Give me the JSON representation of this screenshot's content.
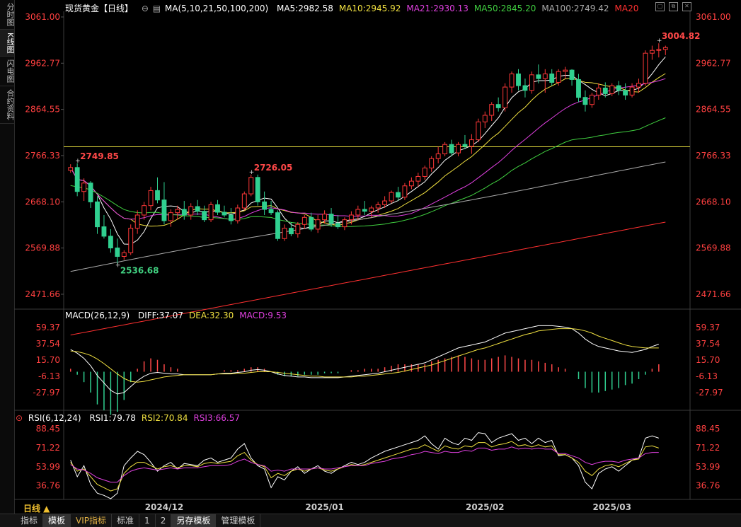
{
  "sidebar": {
    "tabs": [
      "分时图",
      "K线图",
      "闪电图",
      "合约资料"
    ],
    "active": 1
  },
  "main_legend": {
    "instrument": "现货黄金【日线】",
    "ma_params": "MA(5,10,21,50,100,200)",
    "items": [
      {
        "label": "MA5:2982.58",
        "color": "#ffffff"
      },
      {
        "label": "MA10:2945.92",
        "color": "#f0e040"
      },
      {
        "label": "MA21:2930.13",
        "color": "#e040e0"
      },
      {
        "label": "MA50:2845.20",
        "color": "#40d040"
      },
      {
        "label": "MA100:2749.42",
        "color": "#aaaaaa"
      },
      {
        "label": "MA20",
        "color": "#ff3030"
      }
    ]
  },
  "macd_legend": {
    "title": "MACD(26,12,9)",
    "items": [
      {
        "label": "DIFF:37.07",
        "color": "#ffffff"
      },
      {
        "label": "DEA:32.30",
        "color": "#f0e040"
      },
      {
        "label": "MACD:9.53",
        "color": "#e040e0"
      }
    ]
  },
  "rsi_legend": {
    "title": "RSI(6,12,24)",
    "items": [
      {
        "label": "RSI1:79.78",
        "color": "#ffffff"
      },
      {
        "label": "RSI2:70.84",
        "color": "#f0e040"
      },
      {
        "label": "RSI3:66.57",
        "color": "#e040e0"
      }
    ]
  },
  "period_button": "日线 ▲",
  "bottom_tabs": [
    {
      "label": "指标",
      "vip": false,
      "active": false
    },
    {
      "label": "模板",
      "vip": false,
      "active": true
    },
    {
      "label": "VIP指标",
      "vip": true,
      "active": false
    },
    {
      "label": "标准",
      "vip": false,
      "active": false
    },
    {
      "label": "1",
      "vip": false,
      "active": false
    },
    {
      "label": "2",
      "vip": false,
      "active": false
    },
    {
      "label": "另存模板",
      "vip": false,
      "active": true
    },
    {
      "label": "管理模板",
      "vip": false,
      "active": false
    }
  ],
  "colors": {
    "up": "#ff3838",
    "down": "#30d090",
    "price_axis": "#ff4040",
    "hline": "#e8e040"
  },
  "chart_data": [
    {
      "type": "candlestick",
      "title": "现货黄金【日线】",
      "price_ticks": [
        "3061.00",
        "2962.77",
        "2864.55",
        "2766.33",
        "2668.10",
        "2569.88",
        "2471.66"
      ],
      "ylim": [
        2440,
        3070
      ],
      "x_labels": [
        "2024/12",
        "2025/01",
        "2025/02",
        "2025/03"
      ],
      "annotations": [
        {
          "text": "3004.82",
          "type": "high"
        },
        {
          "text": "2749.85",
          "type": "high"
        },
        {
          "text": "2726.05",
          "type": "high"
        },
        {
          "text": "2536.68",
          "type": "low"
        }
      ],
      "horizontal_line": 2785,
      "candles": [
        [
          2735,
          2748,
          2730,
          2741
        ],
        [
          2741,
          2750,
          2680,
          2690
        ],
        [
          2690,
          2718,
          2670,
          2708
        ],
        [
          2708,
          2712,
          2655,
          2668
        ],
        [
          2668,
          2680,
          2600,
          2615
        ],
        [
          2615,
          2640,
          2590,
          2595
        ],
        [
          2595,
          2610,
          2560,
          2570
        ],
        [
          2570,
          2590,
          2537,
          2552
        ],
        [
          2552,
          2565,
          2545,
          2560
        ],
        [
          2560,
          2620,
          2555,
          2612
        ],
        [
          2612,
          2650,
          2600,
          2640
        ],
        [
          2640,
          2668,
          2630,
          2660
        ],
        [
          2660,
          2700,
          2650,
          2692
        ],
        [
          2692,
          2720,
          2665,
          2672
        ],
        [
          2672,
          2710,
          2620,
          2628
        ],
        [
          2628,
          2652,
          2615,
          2645
        ],
        [
          2645,
          2660,
          2630,
          2652
        ],
        [
          2652,
          2670,
          2630,
          2640
        ],
        [
          2640,
          2665,
          2630,
          2658
        ],
        [
          2658,
          2672,
          2640,
          2648
        ],
        [
          2648,
          2660,
          2625,
          2630
        ],
        [
          2630,
          2668,
          2625,
          2662
        ],
        [
          2662,
          2672,
          2640,
          2646
        ],
        [
          2646,
          2660,
          2635,
          2640
        ],
        [
          2640,
          2655,
          2620,
          2628
        ],
        [
          2628,
          2662,
          2622,
          2655
        ],
        [
          2655,
          2690,
          2650,
          2685
        ],
        [
          2685,
          2726,
          2680,
          2720
        ],
        [
          2720,
          2726,
          2660,
          2668
        ],
        [
          2668,
          2690,
          2640,
          2652
        ],
        [
          2652,
          2670,
          2640,
          2645
        ],
        [
          2645,
          2650,
          2585,
          2590
        ],
        [
          2590,
          2620,
          2585,
          2612
        ],
        [
          2612,
          2625,
          2595,
          2600
        ],
        [
          2600,
          2625,
          2592,
          2620
        ],
        [
          2620,
          2640,
          2610,
          2635
        ],
        [
          2635,
          2645,
          2605,
          2610
        ],
        [
          2610,
          2640,
          2602,
          2630
        ],
        [
          2630,
          2650,
          2622,
          2642
        ],
        [
          2642,
          2655,
          2615,
          2622
        ],
        [
          2622,
          2640,
          2610,
          2615
        ],
        [
          2615,
          2635,
          2608,
          2630
        ],
        [
          2630,
          2648,
          2620,
          2640
        ],
        [
          2640,
          2660,
          2630,
          2652
        ],
        [
          2652,
          2670,
          2640,
          2648
        ],
        [
          2648,
          2660,
          2635,
          2655
        ],
        [
          2655,
          2668,
          2645,
          2662
        ],
        [
          2662,
          2680,
          2655,
          2670
        ],
        [
          2670,
          2692,
          2665,
          2688
        ],
        [
          2688,
          2700,
          2670,
          2678
        ],
        [
          2678,
          2708,
          2672,
          2702
        ],
        [
          2702,
          2720,
          2695,
          2712
        ],
        [
          2712,
          2730,
          2700,
          2722
        ],
        [
          2722,
          2745,
          2715,
          2740
        ],
        [
          2740,
          2765,
          2732,
          2760
        ],
        [
          2760,
          2785,
          2750,
          2770
        ],
        [
          2770,
          2795,
          2765,
          2790
        ],
        [
          2790,
          2800,
          2765,
          2772
        ],
        [
          2772,
          2795,
          2765,
          2790
        ],
        [
          2790,
          2810,
          2780,
          2786
        ],
        [
          2786,
          2812,
          2770,
          2800
        ],
        [
          2800,
          2845,
          2795,
          2838
        ],
        [
          2838,
          2860,
          2825,
          2852
        ],
        [
          2852,
          2880,
          2840,
          2875
        ],
        [
          2875,
          2890,
          2860,
          2868
        ],
        [
          2868,
          2920,
          2860,
          2912
        ],
        [
          2912,
          2945,
          2900,
          2940
        ],
        [
          2940,
          2950,
          2905,
          2915
        ],
        [
          2915,
          2930,
          2890,
          2905
        ],
        [
          2905,
          2945,
          2898,
          2938
        ],
        [
          2938,
          2960,
          2920,
          2930
        ],
        [
          2930,
          2950,
          2900,
          2940
        ],
        [
          2940,
          2950,
          2915,
          2922
        ],
        [
          2922,
          2950,
          2915,
          2945
        ],
        [
          2945,
          2955,
          2930,
          2948
        ],
        [
          2948,
          2950,
          2915,
          2928
        ],
        [
          2928,
          2940,
          2880,
          2890
        ],
        [
          2890,
          2905,
          2860,
          2875
        ],
        [
          2875,
          2900,
          2868,
          2895
        ],
        [
          2895,
          2920,
          2885,
          2910
        ],
        [
          2910,
          2922,
          2890,
          2898
        ],
        [
          2898,
          2920,
          2893,
          2915
        ],
        [
          2915,
          2925,
          2895,
          2905
        ],
        [
          2905,
          2920,
          2885,
          2895
        ],
        [
          2895,
          2920,
          2890,
          2912
        ],
        [
          2912,
          2930,
          2900,
          2920
        ],
        [
          2920,
          2990,
          2915,
          2984
        ],
        [
          2984,
          3000,
          2970,
          2990
        ],
        [
          2990,
          3005,
          2975,
          2992
        ],
        [
          2992,
          3000,
          2980,
          2996
        ]
      ]
    },
    {
      "type": "line",
      "title": "MACD(26,12,9)",
      "y_ticks": [
        "59.37",
        "37.54",
        "15.70",
        "-6.13",
        "-27.97"
      ],
      "ylim": [
        -50,
        70
      ],
      "series": [
        {
          "name": "DIFF",
          "values": [
            30,
            25,
            18,
            8,
            -5,
            -15,
            -25,
            -30,
            -28,
            -20,
            -12,
            -6,
            -2,
            -1,
            -2,
            -3,
            -3,
            -4,
            -4,
            -4,
            -4,
            -4,
            -3,
            -2,
            -2,
            -1,
            0,
            2,
            3,
            2,
            0,
            -3,
            -5,
            -6,
            -7,
            -7,
            -8,
            -8,
            -8,
            -8,
            -8,
            -7,
            -6,
            -5,
            -4,
            -3,
            -2,
            0,
            2,
            4,
            6,
            8,
            10,
            12,
            16,
            20,
            24,
            28,
            32,
            34,
            36,
            38,
            40,
            44,
            48,
            52,
            54,
            56,
            58,
            60,
            62,
            62,
            62,
            61,
            60,
            58,
            52,
            44,
            38,
            34,
            32,
            30,
            28,
            27,
            26,
            28,
            30,
            34,
            37
          ]
        },
        {
          "name": "DEA",
          "values": [
            28,
            27,
            25,
            22,
            17,
            11,
            4,
            -3,
            -9,
            -13,
            -14,
            -13,
            -11,
            -9,
            -7,
            -6,
            -5,
            -4,
            -4,
            -4,
            -4,
            -4,
            -3,
            -3,
            -3,
            -2,
            -2,
            -1,
            0,
            0,
            0,
            -1,
            -2,
            -3,
            -4,
            -5,
            -6,
            -6,
            -7,
            -7,
            -7,
            -7,
            -7,
            -6,
            -6,
            -5,
            -4,
            -3,
            -2,
            -1,
            1,
            3,
            5,
            7,
            9,
            12,
            15,
            18,
            21,
            24,
            27,
            30,
            32,
            35,
            38,
            41,
            44,
            47,
            50,
            52,
            55,
            56,
            57,
            58,
            58,
            58,
            57,
            55,
            52,
            48,
            45,
            42,
            39,
            36,
            34,
            33,
            32,
            32,
            32
          ]
        }
      ]
    },
    {
      "type": "line",
      "title": "RSI(6,12,24)",
      "y_ticks": [
        "88.45",
        "71.22",
        "53.99",
        "36.76"
      ],
      "ylim": [
        25,
        95
      ],
      "series": [
        {
          "name": "RSI1",
          "values": [
            60,
            45,
            55,
            38,
            30,
            28,
            25,
            30,
            55,
            62,
            68,
            65,
            58,
            50,
            55,
            58,
            52,
            57,
            56,
            55,
            60,
            62,
            58,
            60,
            62,
            70,
            75,
            62,
            55,
            52,
            35,
            45,
            42,
            50,
            54,
            48,
            52,
            55,
            50,
            48,
            52,
            55,
            58,
            56,
            58,
            62,
            65,
            68,
            70,
            72,
            74,
            76,
            78,
            82,
            75,
            70,
            80,
            76,
            74,
            80,
            78,
            85,
            84,
            76,
            80,
            82,
            84,
            78,
            80,
            75,
            80,
            76,
            78,
            64,
            65,
            62,
            55,
            40,
            34,
            48,
            52,
            54,
            50,
            55,
            60,
            62,
            80,
            82,
            80
          ]
        },
        {
          "name": "RSI2",
          "values": [
            58,
            50,
            52,
            45,
            38,
            35,
            32,
            34,
            48,
            54,
            58,
            58,
            55,
            52,
            54,
            55,
            53,
            55,
            55,
            54,
            57,
            58,
            57,
            58,
            59,
            64,
            67,
            60,
            56,
            54,
            44,
            48,
            46,
            50,
            52,
            50,
            52,
            53,
            51,
            50,
            52,
            54,
            56,
            55,
            56,
            58,
            60,
            62,
            64,
            66,
            68,
            70,
            71,
            74,
            71,
            68,
            73,
            71,
            70,
            73,
            72,
            76,
            76,
            72,
            74,
            75,
            77,
            73,
            74,
            72,
            74,
            72,
            73,
            65,
            65,
            62,
            58,
            50,
            46,
            52,
            55,
            56,
            54,
            57,
            60,
            61,
            72,
            73,
            71
          ]
        },
        {
          "name": "RSI3",
          "values": [
            56,
            52,
            51,
            48,
            44,
            42,
            40,
            40,
            46,
            50,
            52,
            53,
            52,
            51,
            52,
            53,
            52,
            53,
            53,
            53,
            54,
            55,
            55,
            55,
            56,
            59,
            61,
            58,
            56,
            55,
            50,
            51,
            50,
            52,
            52,
            52,
            52,
            53,
            52,
            52,
            53,
            54,
            55,
            55,
            55,
            57,
            58,
            59,
            61,
            62,
            63,
            65,
            66,
            68,
            67,
            66,
            68,
            67,
            67,
            69,
            68,
            71,
            71,
            69,
            70,
            70,
            72,
            70,
            71,
            70,
            71,
            70,
            70,
            66,
            66,
            64,
            62,
            58,
            56,
            58,
            59,
            59,
            58,
            60,
            61,
            62,
            66,
            67,
            67
          ]
        }
      ]
    }
  ]
}
